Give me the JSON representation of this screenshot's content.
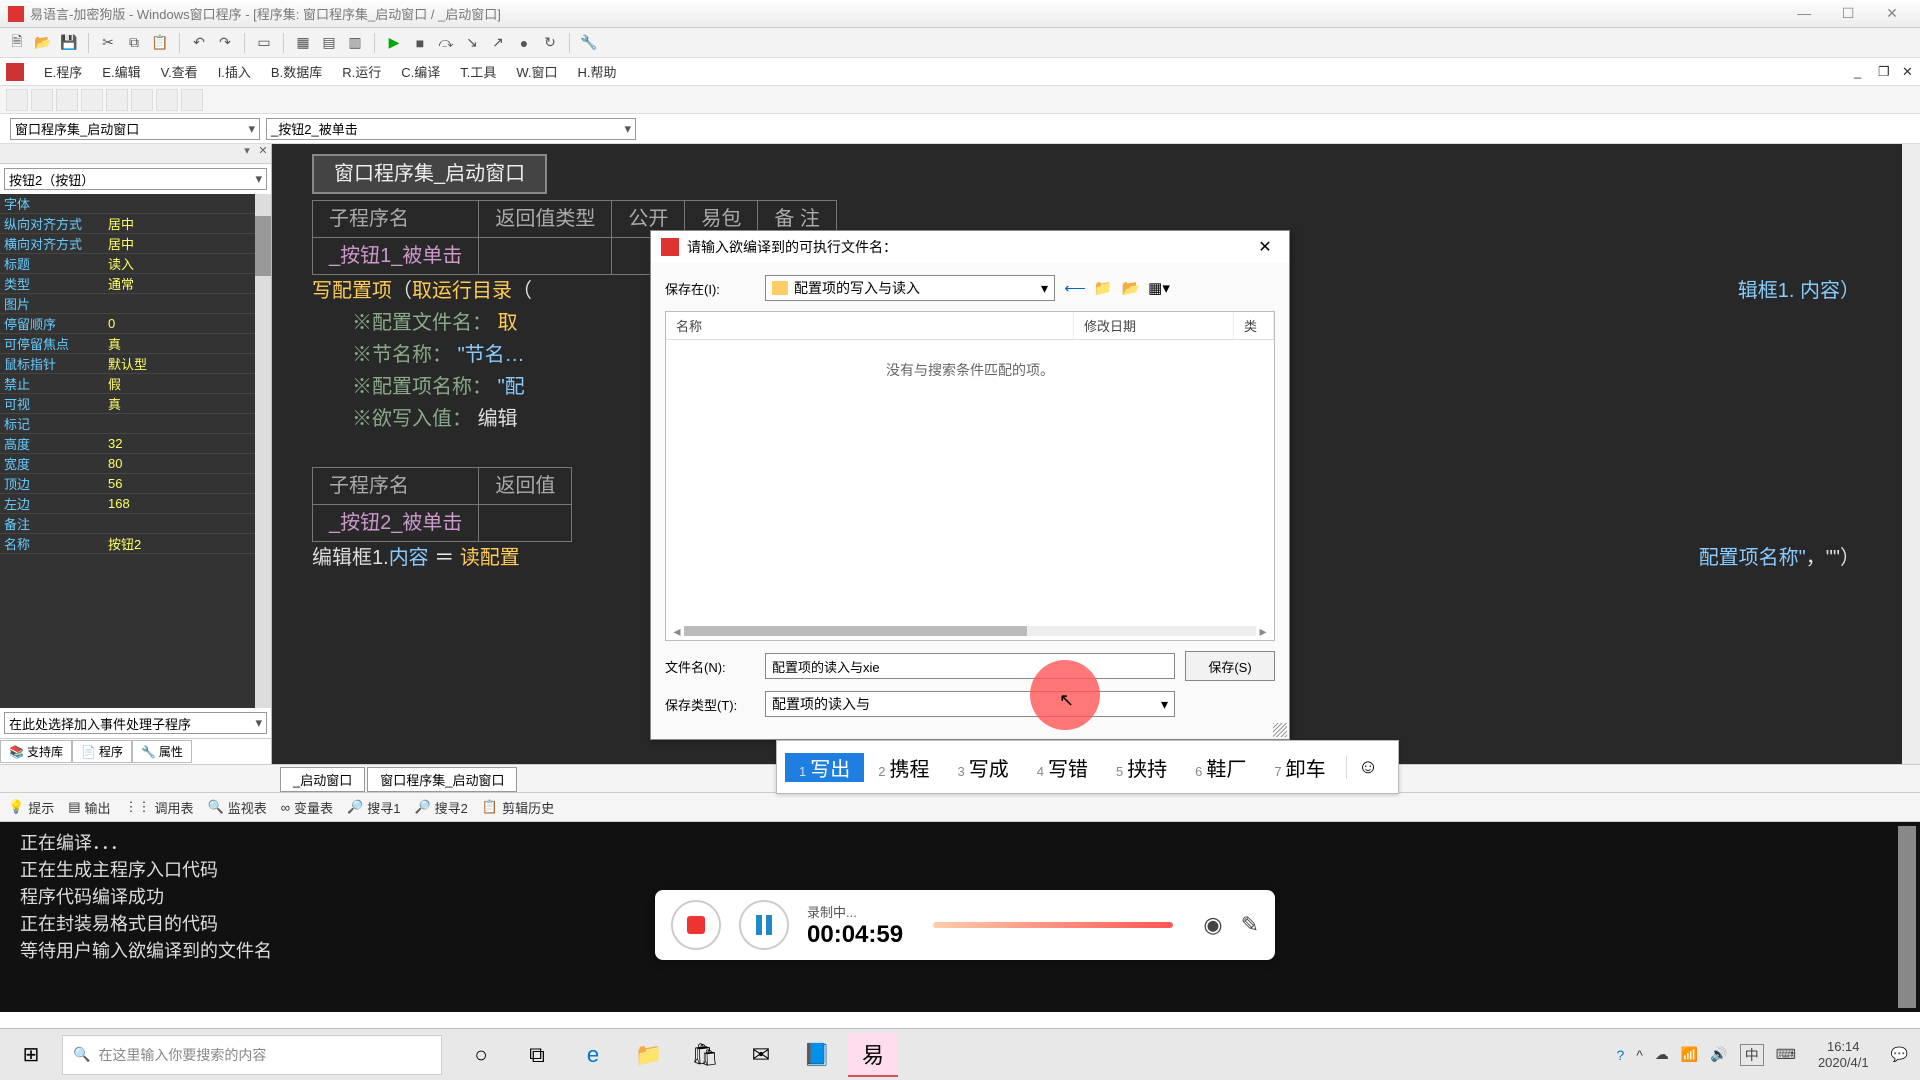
{
  "title": "易语言-加密狗版 - Windows窗口程序 - [程序集: 窗口程序集_启动窗口 / _启动窗口]",
  "menu": [
    "E.程序",
    "E.编辑",
    "V.查看",
    "I.插入",
    "B.数据库",
    "R.运行",
    "C.编译",
    "T.工具",
    "W.窗口",
    "H.帮助"
  ],
  "combo1": "窗口程序集_启动窗口",
  "combo2": "_按钮2_被单击",
  "propSelector": "按钮2（按钮）",
  "props": [
    {
      "k": "名称",
      "v": "按钮2"
    },
    {
      "k": "备注",
      "v": ""
    },
    {
      "k": "左边",
      "v": "168"
    },
    {
      "k": "顶边",
      "v": "56"
    },
    {
      "k": "宽度",
      "v": "80"
    },
    {
      "k": "高度",
      "v": "32"
    },
    {
      "k": "标记",
      "v": ""
    },
    {
      "k": "可视",
      "v": "真"
    },
    {
      "k": "禁止",
      "v": "假"
    },
    {
      "k": "鼠标指针",
      "v": "默认型"
    },
    {
      "k": "可停留焦点",
      "v": "真"
    },
    {
      "k": "停留顺序",
      "v": "0"
    },
    {
      "k": "图片",
      "v": ""
    },
    {
      "k": "类型",
      "v": "通常"
    },
    {
      "k": "标题",
      "v": "读入"
    },
    {
      "k": "横向对齐方式",
      "v": "居中"
    },
    {
      "k": "纵向对齐方式",
      "v": "居中"
    },
    {
      "k": "字体",
      "v": ""
    }
  ],
  "eventCombo": "在此处选择加入事件处理子程序",
  "leftTabs": [
    "支持库",
    "程序",
    "属性"
  ],
  "editor": {
    "head": "窗口程序集_启动窗口",
    "cols1": [
      "子程序名",
      "返回值类型",
      "公开",
      "易包",
      "备 注"
    ],
    "fn1": "_按钮1_被单击",
    "l1a": "写配置项",
    "l1b": "取运行目录",
    "l1tail": "辑框1. 内容）",
    "c1": "※配置文件名：",
    "c1v": "取",
    "c2": "※节名称：",
    "c2v": "\"节名…",
    "c3": "※配置项名称：",
    "c3v": "\"配",
    "c4": "※欲写入值：",
    "c4v": "编辑",
    "cols2": [
      "子程序名",
      "返回值"
    ],
    "fn2": "_按钮2_被单击",
    "l2a": "编辑框1.",
    "l2b": "内容",
    "l2c": "＝",
    "l2d": "读配置",
    "l2tail1": "配置项名称\"",
    "l2tail2": "，\"\"）"
  },
  "edTabs": [
    "_启动窗口",
    "窗口程序集_启动窗口"
  ],
  "bottomItems": [
    "提示",
    "输出",
    "调用表",
    "监视表",
    "变量表",
    "搜寻1",
    "搜寻2",
    "剪辑历史"
  ],
  "outputLines": [
    "正在编译．．．",
    "正在生成主程序入口代码",
    "程序代码编译成功",
    "正在封装易格式目的代码",
    "等待用户输入欲编译到的文件名"
  ],
  "dialog": {
    "title": "请输入欲编译到的可执行文件名：",
    "saveInLbl": "保存在(I):",
    "saveInVal": "配置项的写入与读入",
    "colName": "名称",
    "colDate": "修改日期",
    "colType": "类",
    "empty": "没有与搜索条件匹配的项。",
    "fileLbl": "文件名(N):",
    "fileVal": "配置项的读入与xie",
    "typeLbl": "保存类型(T):",
    "typeVal": "配置项的读入与",
    "saveBtn": "保存(S)"
  },
  "ime": {
    "candidates": [
      {
        "n": "1",
        "t": "写出"
      },
      {
        "n": "2",
        "t": "携程"
      },
      {
        "n": "3",
        "t": "写成"
      },
      {
        "n": "4",
        "t": "写错"
      },
      {
        "n": "5",
        "t": "挟持"
      },
      {
        "n": "6",
        "t": "鞋厂"
      },
      {
        "n": "7",
        "t": "卸车"
      }
    ]
  },
  "recorder": {
    "status": "录制中...",
    "time": "00:04:59"
  },
  "taskbar": {
    "searchPlaceholder": "在这里输入你要搜索的内容",
    "langBadge": "中",
    "time": "16:14",
    "date": "2020/4/1"
  }
}
